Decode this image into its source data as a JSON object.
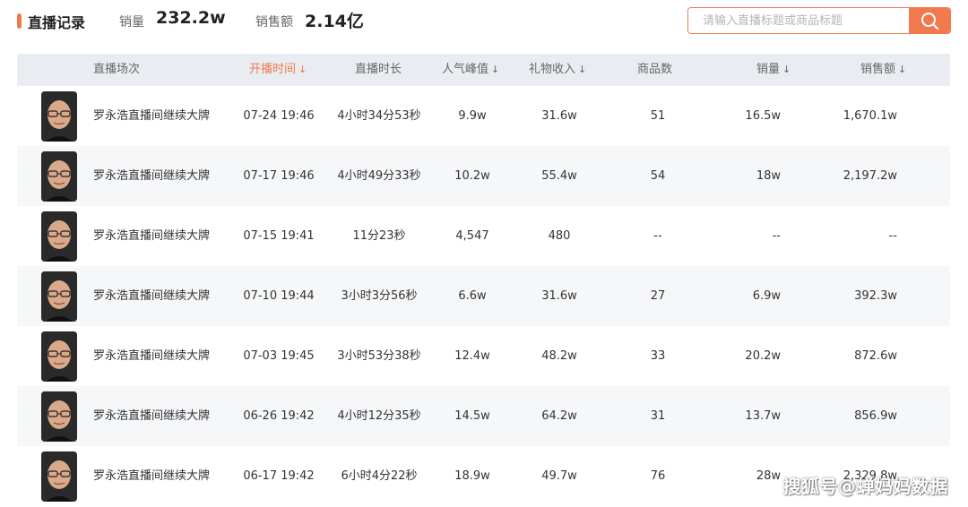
{
  "header": {
    "title": "直播记录",
    "sales_volume_label": "销量",
    "sales_volume_value": "232.2w",
    "sales_amount_label": "销售额",
    "sales_amount_value": "2.14亿"
  },
  "search": {
    "placeholder": "请输入直播标题或商品标题",
    "icon": "search-icon"
  },
  "accent_color": "#f07a4e",
  "table": {
    "columns": [
      "直播场次",
      "开播时间",
      "直播时长",
      "人气峰值",
      "礼物收入",
      "商品数",
      "销量",
      "销售额"
    ],
    "sort_arrow": "↓",
    "rows": [
      {
        "name": "罗永浩直播间继续大牌",
        "start": "07-24 19:46",
        "duration": "4小时34分53秒",
        "peak": "9.9w",
        "gift": "31.6w",
        "items": "51",
        "sales": "16.5w",
        "amount": "1,670.1w"
      },
      {
        "name": "罗永浩直播间继续大牌",
        "start": "07-17 19:46",
        "duration": "4小时49分33秒",
        "peak": "10.2w",
        "gift": "55.4w",
        "items": "54",
        "sales": "18w",
        "amount": "2,197.2w"
      },
      {
        "name": "罗永浩直播间继续大牌",
        "start": "07-15 19:41",
        "duration": "11分23秒",
        "peak": "4,547",
        "gift": "480",
        "items": "--",
        "sales": "--",
        "amount": "--"
      },
      {
        "name": "罗永浩直播间继续大牌",
        "start": "07-10 19:44",
        "duration": "3小时3分56秒",
        "peak": "6.6w",
        "gift": "31.6w",
        "items": "27",
        "sales": "6.9w",
        "amount": "392.3w"
      },
      {
        "name": "罗永浩直播间继续大牌",
        "start": "07-03 19:45",
        "duration": "3小时53分38秒",
        "peak": "12.4w",
        "gift": "48.2w",
        "items": "33",
        "sales": "20.2w",
        "amount": "872.6w"
      },
      {
        "name": "罗永浩直播间继续大牌",
        "start": "06-26 19:42",
        "duration": "4小时12分35秒",
        "peak": "14.5w",
        "gift": "64.2w",
        "items": "31",
        "sales": "13.7w",
        "amount": "856.9w"
      },
      {
        "name": "罗永浩直播间继续大牌",
        "start": "06-17 19:42",
        "duration": "6小时4分22秒",
        "peak": "18.9w",
        "gift": "49.7w",
        "items": "76",
        "sales": "28w",
        "amount": "2,329.8w"
      }
    ]
  },
  "watermark": "搜狐号@蝉妈妈数据"
}
